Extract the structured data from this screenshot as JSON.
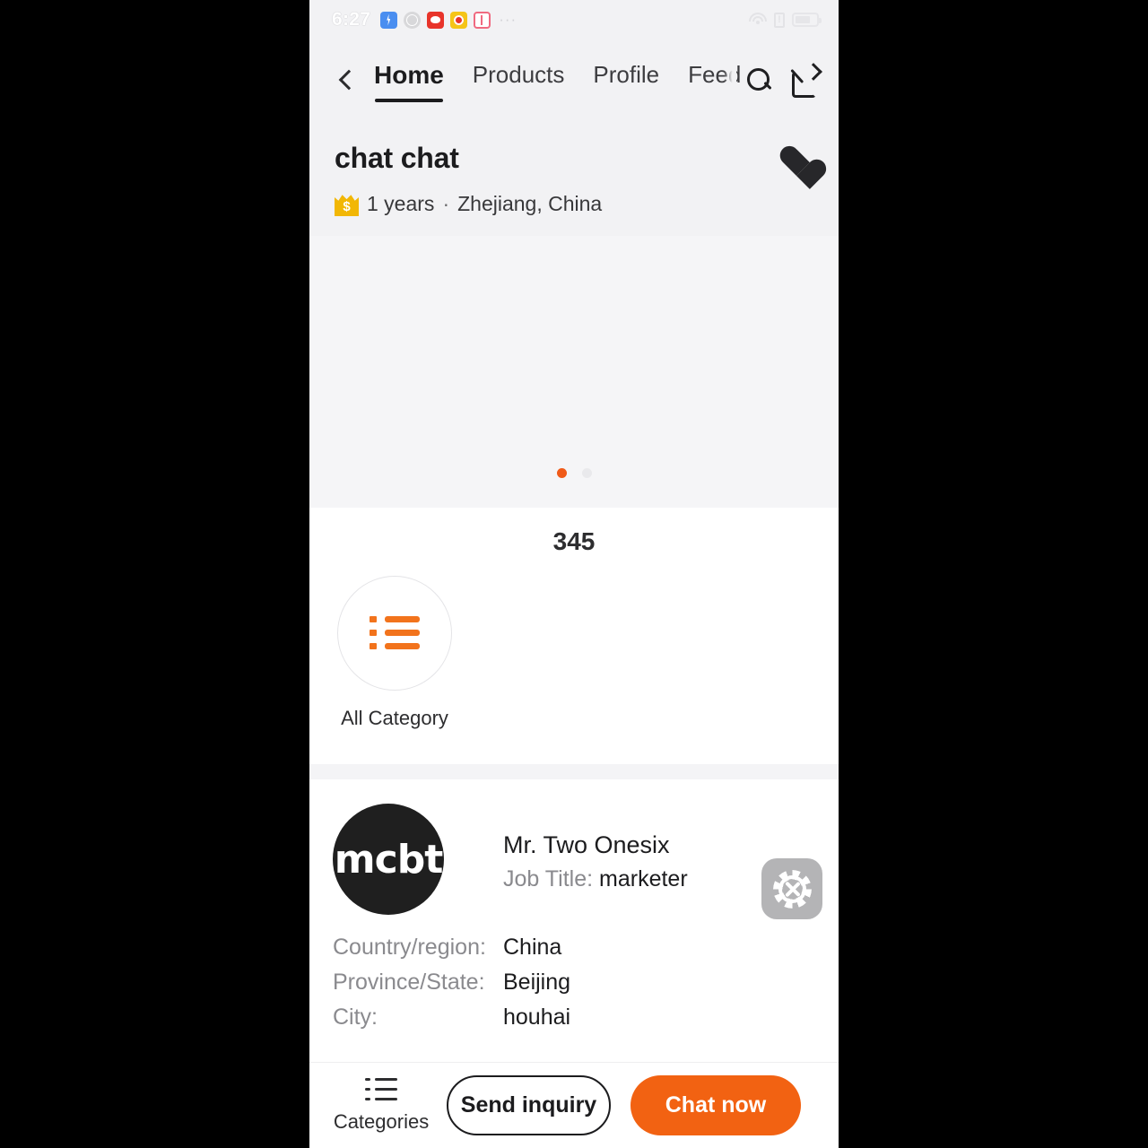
{
  "status_bar": {
    "time": "6:27",
    "left_icons": [
      "battery-charging-icon",
      "globe-icon",
      "wechat-icon",
      "weibo-icon",
      "book-icon"
    ],
    "overflow": "···",
    "right_icons": [
      "wifi-icon",
      "signal-alert-icon",
      "battery-icon"
    ]
  },
  "nav": {
    "back": "‹",
    "tabs": [
      {
        "label": "Home",
        "active": true
      },
      {
        "label": "Products",
        "active": false
      },
      {
        "label": "Profile",
        "active": false
      },
      {
        "label": "Feed",
        "active": false
      }
    ],
    "actions": [
      "search-icon",
      "share-icon"
    ]
  },
  "company": {
    "name": "chat chat",
    "badge": "gold-crown-dollar-badge",
    "years": "1 years",
    "separator": "·",
    "location": "Zhejiang, China",
    "favorite": "heart-filled-icon"
  },
  "carousel": {
    "slides": 2,
    "active_index": 0
  },
  "categories": {
    "count": "345",
    "items": [
      {
        "label": "All Category",
        "icon": "list-icon"
      }
    ]
  },
  "contact": {
    "avatar_text": "mcbt",
    "name": "Mr. Two Onesix",
    "job_label": "Job Title:",
    "job_value": "marketer",
    "settings_icon": "gear-tools-icon",
    "address": [
      {
        "key": "Country/region:",
        "value": "China"
      },
      {
        "key": "Province/State:",
        "value": "Beijing"
      },
      {
        "key": "City:",
        "value": "houhai"
      }
    ]
  },
  "bottom_bar": {
    "categories_label": "Categories",
    "categories_icon": "list-icon",
    "send_inquiry_label": "Send inquiry",
    "chat_now_label": "Chat now"
  },
  "colors": {
    "accent_orange": "#f26212",
    "dot_active": "#f05a18",
    "badge_gold": "#f2b705",
    "avatar_bg": "#1f1f1f",
    "header_bg": "#f2f2f4",
    "gear_bg": "#b4b4b6"
  }
}
